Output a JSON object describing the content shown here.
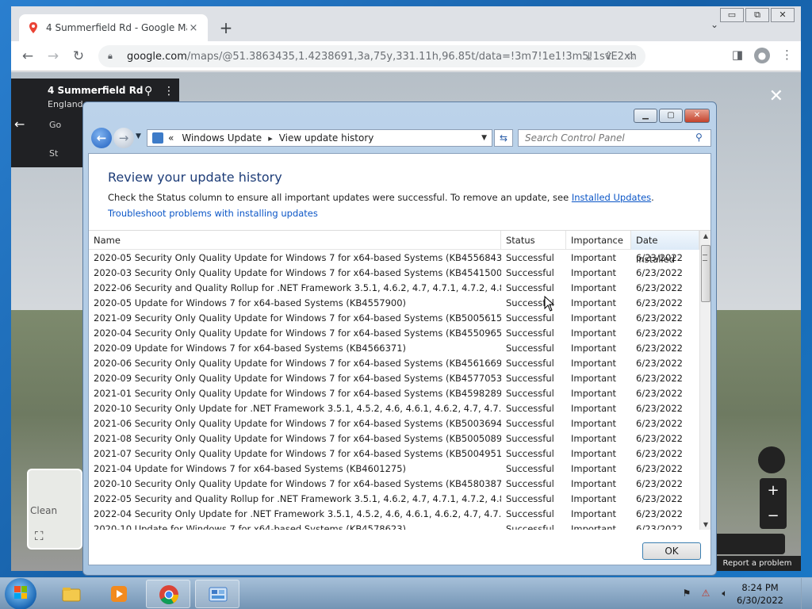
{
  "browser": {
    "tab_title": "4 Summerfield Rd - Google Map",
    "tab_close": "×",
    "new_tab": "+",
    "url_host": "google.com",
    "url_path": "/maps/@51.3863435,1.4238691,3a,75y,331.11h,96.85t/data=!3m7!1e1!3m5!1svE2xhd0kXtU...",
    "minimize": "▭",
    "restore": "⧉",
    "close": "✕"
  },
  "maps": {
    "place_title": "4 Summerfield Rd",
    "place_subtitle": "England",
    "go_label": "Go",
    "st_label": "St",
    "minimap_label": "Clean",
    "report": "Report a problem"
  },
  "dialog": {
    "breadcrumb_root": "Windows Update",
    "breadcrumb_page": "View update history",
    "search_placeholder": "Search Control Panel",
    "heading": "Review your update history",
    "desc_before": "Check the Status column to ensure all important updates were successful. To remove an update, see ",
    "desc_link": "Installed Updates",
    "desc_after": ".",
    "troubleshoot": "Troubleshoot problems with installing updates",
    "columns": {
      "name": "Name",
      "status": "Status",
      "importance": "Importance",
      "date": "Date Installed"
    },
    "rows": [
      {
        "name": "2020-05 Security Only Quality Update for Windows 7 for x64-based Systems (KB4556843)",
        "status": "Successful",
        "importance": "Important",
        "date": "6/23/2022"
      },
      {
        "name": "2020-03 Security Only Quality Update for Windows 7 for x64-based Systems (KB4541500)",
        "status": "Successful",
        "importance": "Important",
        "date": "6/23/2022"
      },
      {
        "name": "2022-06 Security and Quality Rollup for .NET Framework 3.5.1, 4.6.2, 4.7, 4.7.1, 4.7.2, 4.8 for Wind...",
        "status": "Successful",
        "importance": "Important",
        "date": "6/23/2022"
      },
      {
        "name": "2020-05 Update for Windows 7 for x64-based Systems (KB4557900)",
        "status": "Successful",
        "importance": "Important",
        "date": "6/23/2022"
      },
      {
        "name": "2021-09 Security Only Quality Update for Windows 7 for x64-based Systems (KB5005615)",
        "status": "Successful",
        "importance": "Important",
        "date": "6/23/2022"
      },
      {
        "name": "2020-04 Security Only Quality Update for Windows 7 for x64-based Systems (KB4550965)",
        "status": "Successful",
        "importance": "Important",
        "date": "6/23/2022"
      },
      {
        "name": "2020-09 Update for Windows 7 for x64-based Systems (KB4566371)",
        "status": "Successful",
        "importance": "Important",
        "date": "6/23/2022"
      },
      {
        "name": "2020-06 Security Only Quality Update for Windows 7 for x64-based Systems (KB4561669)",
        "status": "Successful",
        "importance": "Important",
        "date": "6/23/2022"
      },
      {
        "name": "2020-09 Security Only Quality Update for Windows 7 for x64-based Systems (KB4577053)",
        "status": "Successful",
        "importance": "Important",
        "date": "6/23/2022"
      },
      {
        "name": "2021-01 Security Only Quality Update for Windows 7 for x64-based Systems (KB4598289)",
        "status": "Successful",
        "importance": "Important",
        "date": "6/23/2022"
      },
      {
        "name": "2020-10 Security Only Update for .NET Framework 3.5.1, 4.5.2, 4.6, 4.6.1, 4.6.2, 4.7, 4.7.1, 4.7.2, 4.8...",
        "status": "Successful",
        "importance": "Important",
        "date": "6/23/2022"
      },
      {
        "name": "2021-06 Security Only Quality Update for Windows 7 for x64-based Systems (KB5003694)",
        "status": "Successful",
        "importance": "Important",
        "date": "6/23/2022"
      },
      {
        "name": "2021-08 Security Only Quality Update for Windows 7 for x64-based Systems (KB5005089)",
        "status": "Successful",
        "importance": "Important",
        "date": "6/23/2022"
      },
      {
        "name": "2021-07 Security Only Quality Update for Windows 7 for x64-based Systems (KB5004951)",
        "status": "Successful",
        "importance": "Important",
        "date": "6/23/2022"
      },
      {
        "name": "2021-04 Update for Windows 7 for x64-based Systems (KB4601275)",
        "status": "Successful",
        "importance": "Important",
        "date": "6/23/2022"
      },
      {
        "name": "2020-10 Security Only Quality Update for Windows 7 for x64-based Systems (KB4580387)",
        "status": "Successful",
        "importance": "Important",
        "date": "6/23/2022"
      },
      {
        "name": "2022-05 Security and Quality Rollup for .NET Framework 3.5.1, 4.6.2, 4.7, 4.7.1, 4.7.2, 4.8 for Wind...",
        "status": "Successful",
        "importance": "Important",
        "date": "6/23/2022"
      },
      {
        "name": "2022-04 Security Only Update for .NET Framework 3.5.1, 4.5.2, 4.6, 4.6.1, 4.6.2, 4.7, 4.7.1, 4.7.2, 4.8...",
        "status": "Successful",
        "importance": "Important",
        "date": "6/23/2022"
      },
      {
        "name": "2020-10 Update for Windows 7 for x64-based Systems (KB4578623)",
        "status": "Successful",
        "importance": "Important",
        "date": "6/23/2022"
      }
    ],
    "ok_label": "OK"
  },
  "taskbar": {
    "time": "8:24 PM",
    "date": "6/30/2022"
  },
  "colors": {
    "link": "#0b56c7",
    "heading": "#1e3d78",
    "close_red": "#c3422b"
  }
}
